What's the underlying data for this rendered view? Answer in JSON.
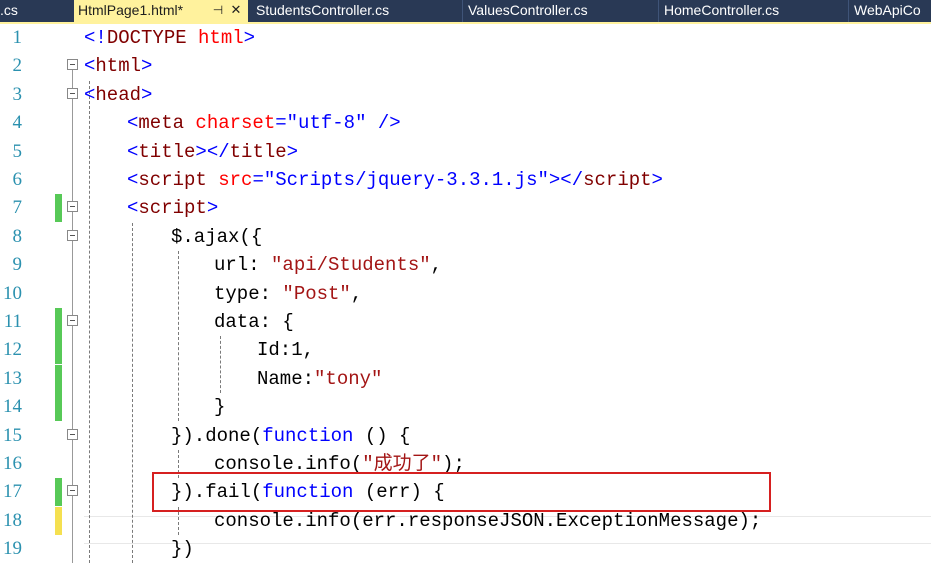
{
  "tabs": [
    {
      "label": ".cs",
      "active": false
    },
    {
      "label": "HtmlPage1.html*",
      "active": true,
      "pin_glyph": "⊣",
      "close_glyph": "✕"
    },
    {
      "label": "StudentsController.cs",
      "active": false
    },
    {
      "label": "ValuesController.cs",
      "active": false
    },
    {
      "label": "HomeController.cs",
      "active": false
    },
    {
      "label": "WebApiCo",
      "active": false
    }
  ],
  "editor": {
    "lines": [
      {
        "num": "1",
        "change": "",
        "fold": false,
        "tokens": [
          [
            "delim",
            "<!"
          ],
          [
            "tag",
            "DOCTYPE "
          ],
          [
            "attr",
            "html"
          ],
          [
            "delim",
            ">"
          ]
        ]
      },
      {
        "num": "2",
        "change": "",
        "fold": true,
        "tokens": [
          [
            "delim",
            "<"
          ],
          [
            "tag",
            "html"
          ],
          [
            "delim",
            ">"
          ]
        ]
      },
      {
        "num": "3",
        "change": "",
        "fold": true,
        "tokens": [
          [
            "delim",
            "<"
          ],
          [
            "tag",
            "head"
          ],
          [
            "delim",
            ">"
          ]
        ]
      },
      {
        "num": "4",
        "change": "",
        "fold": false,
        "tokens": [
          [
            "delim",
            "<"
          ],
          [
            "tag",
            "meta "
          ],
          [
            "attr",
            "charset"
          ],
          [
            "delim",
            "="
          ],
          [
            "aval",
            "\"utf-8\""
          ],
          [
            "delim",
            " />"
          ]
        ]
      },
      {
        "num": "5",
        "change": "",
        "fold": false,
        "tokens": [
          [
            "delim",
            "<"
          ],
          [
            "tag",
            "title"
          ],
          [
            "delim",
            "></"
          ],
          [
            "tag",
            "title"
          ],
          [
            "delim",
            ">"
          ]
        ]
      },
      {
        "num": "6",
        "change": "",
        "fold": false,
        "tokens": [
          [
            "delim",
            "<"
          ],
          [
            "tag",
            "script "
          ],
          [
            "attr",
            "src"
          ],
          [
            "delim",
            "="
          ],
          [
            "aval",
            "\"Scripts/jquery-3.3.1.js\""
          ],
          [
            "delim",
            "></"
          ],
          [
            "tag",
            "script"
          ],
          [
            "delim",
            ">"
          ]
        ]
      },
      {
        "num": "7",
        "change": "saved",
        "fold": true,
        "tokens": [
          [
            "delim",
            "<"
          ],
          [
            "tag",
            "script"
          ],
          [
            "delim",
            ">"
          ]
        ]
      },
      {
        "num": "8",
        "change": "",
        "fold": true,
        "tokens": [
          [
            "plain",
            "$.ajax({"
          ]
        ]
      },
      {
        "num": "9",
        "change": "",
        "fold": false,
        "tokens": [
          [
            "plain",
            "url: "
          ],
          [
            "str",
            "\"api/Students\""
          ],
          [
            "plain",
            ","
          ]
        ]
      },
      {
        "num": "10",
        "change": "",
        "fold": false,
        "tokens": [
          [
            "plain",
            "type: "
          ],
          [
            "str",
            "\"Post\""
          ],
          [
            "plain",
            ","
          ]
        ]
      },
      {
        "num": "11",
        "change": "saved",
        "fold": true,
        "tokens": [
          [
            "plain",
            "data: {"
          ]
        ]
      },
      {
        "num": "12",
        "change": "saved",
        "fold": false,
        "tokens": [
          [
            "plain",
            "Id:1,"
          ]
        ]
      },
      {
        "num": "13",
        "change": "saved",
        "fold": false,
        "tokens": [
          [
            "plain",
            "Name:"
          ],
          [
            "str",
            "\"tony\""
          ]
        ]
      },
      {
        "num": "14",
        "change": "saved",
        "fold": false,
        "tokens": [
          [
            "plain",
            "}"
          ]
        ]
      },
      {
        "num": "15",
        "change": "",
        "fold": true,
        "tokens": [
          [
            "plain",
            "}).done("
          ],
          [
            "kw",
            "function"
          ],
          [
            "plain",
            " () {"
          ]
        ]
      },
      {
        "num": "16",
        "change": "",
        "fold": false,
        "tokens": [
          [
            "plain",
            "console.info("
          ],
          [
            "str",
            "\"成功了\""
          ],
          [
            "plain",
            ");"
          ]
        ]
      },
      {
        "num": "17",
        "change": "saved",
        "fold": true,
        "tokens": [
          [
            "plain",
            "}).fail("
          ],
          [
            "kw",
            "function"
          ],
          [
            "plain",
            " (err) {"
          ]
        ]
      },
      {
        "num": "18",
        "change": "unsaved",
        "fold": false,
        "tokens": [
          [
            "plain",
            "console.info(err.responseJSON.ExceptionMessage);"
          ]
        ]
      },
      {
        "num": "19",
        "change": "",
        "fold": false,
        "tokens": [
          [
            "plain",
            "})"
          ]
        ]
      }
    ]
  },
  "colors": {
    "tab_bar": "#293955",
    "active_tab": "#fff29d",
    "line_number": "#2b91af",
    "html_tag": "#800000",
    "html_delimiter": "#0000ff",
    "html_attribute": "#ff0000",
    "keyword": "#0000ff",
    "string": "#a31515",
    "change_saved": "#57c957",
    "change_unsaved": "#f5e050",
    "callout_border": "#d62020"
  },
  "icons": {
    "fold": "collapse-minus-icon",
    "pin": "pin-icon",
    "close": "close-icon"
  }
}
